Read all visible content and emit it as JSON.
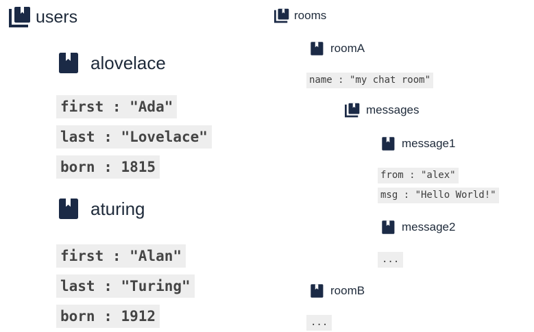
{
  "users": {
    "title": "users",
    "docs": [
      {
        "id": "alovelace",
        "fields": [
          "first : \"Ada\"",
          "last : \"Lovelace\"",
          "born : 1815"
        ]
      },
      {
        "id": "aturing",
        "fields": [
          "first : \"Alan\"",
          "last : \"Turing\"",
          "born : 1912"
        ]
      }
    ]
  },
  "rooms": {
    "title": "rooms",
    "roomA": {
      "id": "roomA",
      "fields": [
        "name : \"my chat room\""
      ],
      "messages": {
        "title": "messages",
        "message1": {
          "id": "message1",
          "fields": [
            "from : \"alex\"",
            "msg : \"Hello World!\""
          ]
        },
        "message2": {
          "id": "message2",
          "ellipsis": "..."
        }
      }
    },
    "roomB": {
      "id": "roomB",
      "ellipsis": "..."
    }
  },
  "icons": {
    "collection": "collection-icon",
    "document": "document-icon"
  },
  "colors": {
    "icon": "#1b2a46",
    "field_bg": "#eeeeee",
    "text": "#1e2a3a"
  }
}
